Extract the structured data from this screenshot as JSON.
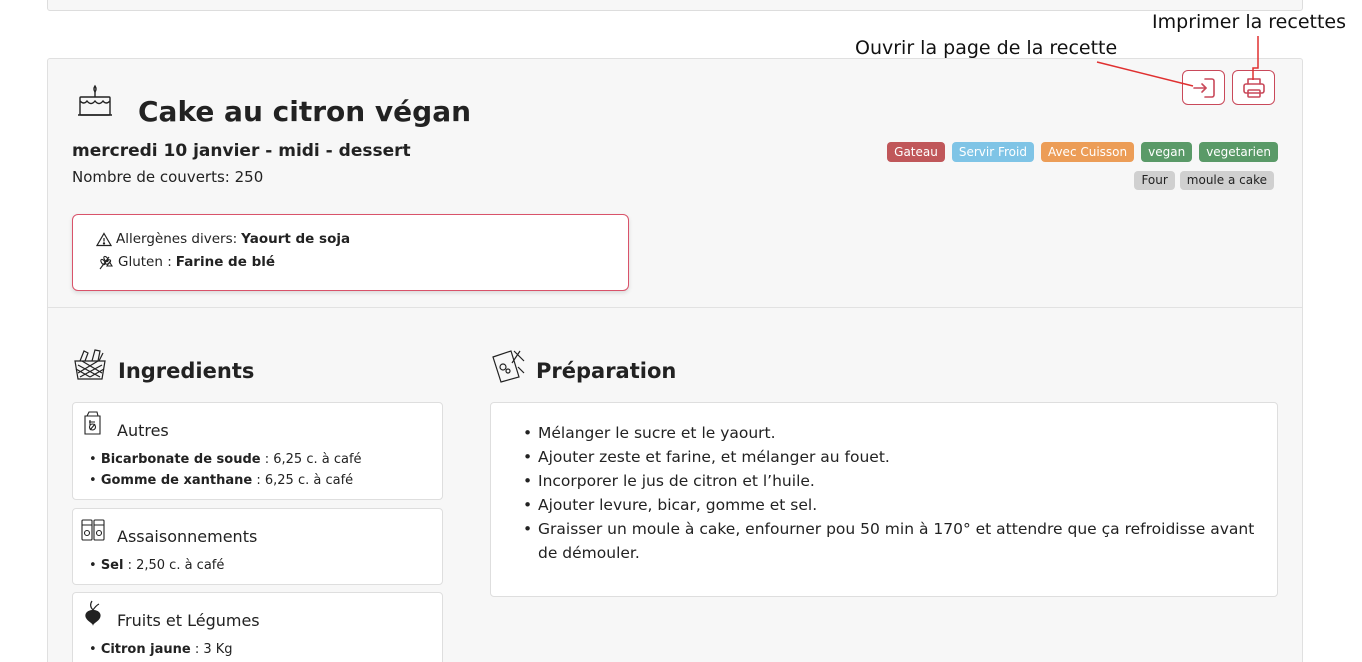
{
  "annotations": {
    "print": "Imprimer la recettes",
    "open": "Ouvrir la page de la recette"
  },
  "recipe": {
    "title": "Cake au citron végan",
    "date_line": "mercredi 10 janvier - midi - dessert",
    "covers": "Nombre de couverts: 250",
    "tags": [
      {
        "label": "Gateau",
        "color": "#c0575a"
      },
      {
        "label": "Servir Froid",
        "color": "#7fc4e6"
      },
      {
        "label": "Avec Cuisson",
        "color": "#ec9d57"
      },
      {
        "label": "vegan",
        "color": "#5a9a68"
      },
      {
        "label": "vegetarien",
        "color": "#5a9a68"
      }
    ],
    "equipment": [
      "Four",
      "moule a cake"
    ],
    "allergens": [
      {
        "icon": "warning-icon",
        "label": "Allergènes divers: ",
        "value": "Yaourt de soja"
      },
      {
        "icon": "wheat-icon",
        "label": "Gluten : ",
        "value": "Farine de blé"
      }
    ]
  },
  "ingredients": {
    "title": "Ingredients",
    "groups": [
      {
        "name": "Autres",
        "icon": "package-icon",
        "items": [
          {
            "name": "Bicarbonate de soude",
            "qty": " : 6,25 c. à café"
          },
          {
            "name": "Gomme de xanthane",
            "qty": " : 6,25 c. à café"
          }
        ]
      },
      {
        "name": "Assaisonnements",
        "icon": "spice-jars-icon",
        "items": [
          {
            "name": "Sel",
            "qty": " : 2,50 c. à café"
          }
        ]
      },
      {
        "name": "Fruits et Légumes",
        "icon": "beet-icon",
        "items": [
          {
            "name": "Citron jaune",
            "qty": " : 3 Kg"
          }
        ]
      }
    ]
  },
  "preparation": {
    "title": "Préparation",
    "steps": [
      "Mélanger le sucre et le yaourt.",
      "Ajouter zeste et farine, et mélanger au fouet.",
      "Incorporer le jus de citron et l’huile.",
      "Ajouter levure, bicar, gomme et sel.",
      "Graisser un moule à cake, enfourner pou 50 min à 170° et attendre que ça refroidisse avant de démouler."
    ]
  },
  "colors": {
    "accent": "#c9495a",
    "annotation_line": "#e03030"
  }
}
